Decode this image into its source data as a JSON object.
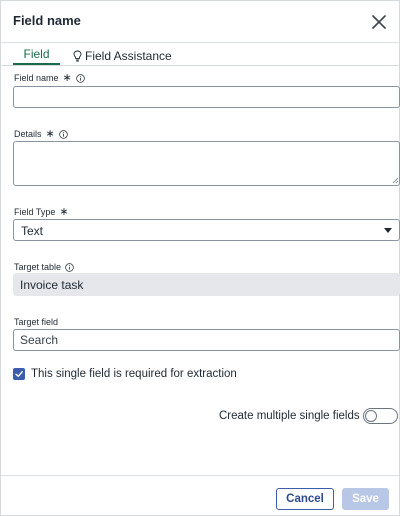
{
  "dialog": {
    "title": "Field name"
  },
  "tabs": [
    {
      "label": "Field",
      "active": true
    },
    {
      "label": "Field Assistance",
      "icon": "lightbulb-icon",
      "active": false
    }
  ],
  "form": {
    "field_name": {
      "label": "Field name",
      "required": true,
      "value": ""
    },
    "details": {
      "label": "Details",
      "required": true,
      "value": ""
    },
    "field_type": {
      "label": "Field Type",
      "required": true,
      "selected": "Text"
    },
    "target_table": {
      "label": "Target table",
      "value": "Invoice task"
    },
    "target_field": {
      "label": "Target field",
      "placeholder": "Search",
      "value": ""
    },
    "required_checkbox": {
      "label": "This single field is required for extraction",
      "checked": true
    },
    "multiple_toggle": {
      "label": "Create multiple single fields",
      "on": false
    }
  },
  "footer": {
    "cancel_label": "Cancel",
    "save_label": "Save"
  },
  "colors": {
    "accent_tab": "#1a6b4a",
    "primary": "#3b5dab",
    "save_disabled": "#b8c7e6",
    "readonly_bg": "#e5e7ea"
  }
}
